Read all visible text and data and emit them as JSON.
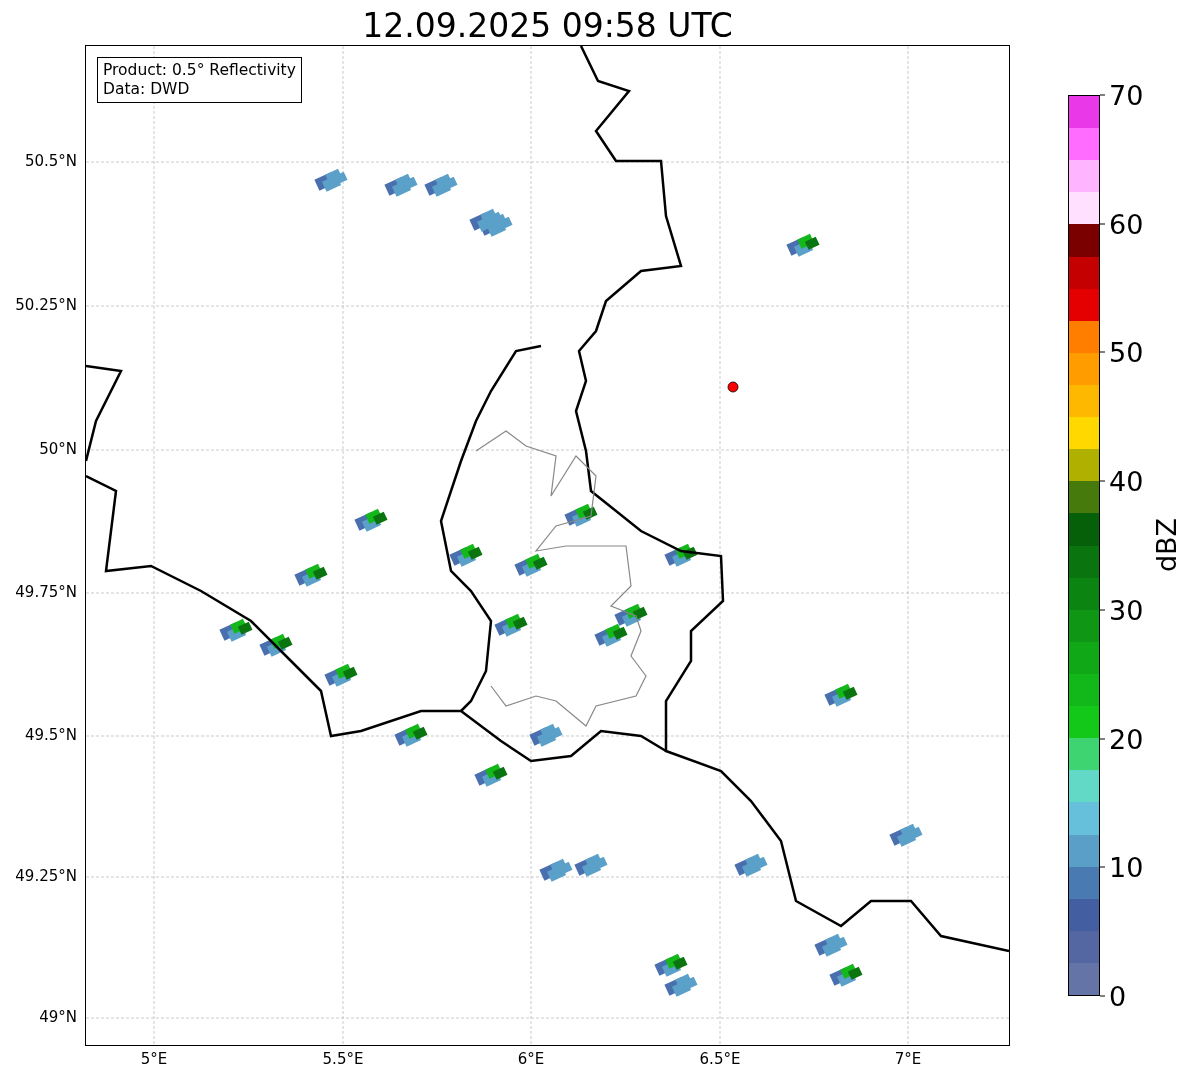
{
  "title": "12.09.2025 09:58 UTC",
  "info_box": {
    "lines": [
      "Product: 0.5° Reflectivity",
      "Data: DWD"
    ]
  },
  "map": {
    "y_tick_labels": [
      "50.5°N",
      "50.25°N",
      "50°N",
      "49.75°N",
      "49.5°N",
      "49.25°N",
      "49°N"
    ],
    "x_tick_labels": [
      "5°E",
      "5.5°E",
      "6°E",
      "6.5°E",
      "7°E"
    ]
  },
  "colorbar": {
    "label": "dBZ",
    "ticks": [
      "70",
      "60",
      "50",
      "40",
      "30",
      "20",
      "10",
      "0"
    ],
    "bands": [
      {
        "color": "#e838e8"
      },
      {
        "color": "#ff6cff"
      },
      {
        "color": "#ffb4ff"
      },
      {
        "color": "#ffe0ff"
      },
      {
        "color": "#7a0000"
      },
      {
        "color": "#c40000"
      },
      {
        "color": "#e40000"
      },
      {
        "color": "#ff7e00"
      },
      {
        "color": "#ff9c00"
      },
      {
        "color": "#ffb800"
      },
      {
        "color": "#ffd800"
      },
      {
        "color": "#b0b000"
      },
      {
        "color": "#477a0c"
      },
      {
        "color": "#06600a"
      },
      {
        "color": "#0a740f"
      },
      {
        "color": "#0c8412"
      },
      {
        "color": "#0e9614"
      },
      {
        "color": "#10a816"
      },
      {
        "color": "#12b81a"
      },
      {
        "color": "#14c81a"
      },
      {
        "color": "#3dd471"
      },
      {
        "color": "#62d8c6"
      },
      {
        "color": "#66c0dc"
      },
      {
        "color": "#5a9fc7"
      },
      {
        "color": "#4a7ab2"
      },
      {
        "color": "#445ea2"
      },
      {
        "color": "#5467a2"
      },
      {
        "color": "#6574a6"
      }
    ]
  }
}
